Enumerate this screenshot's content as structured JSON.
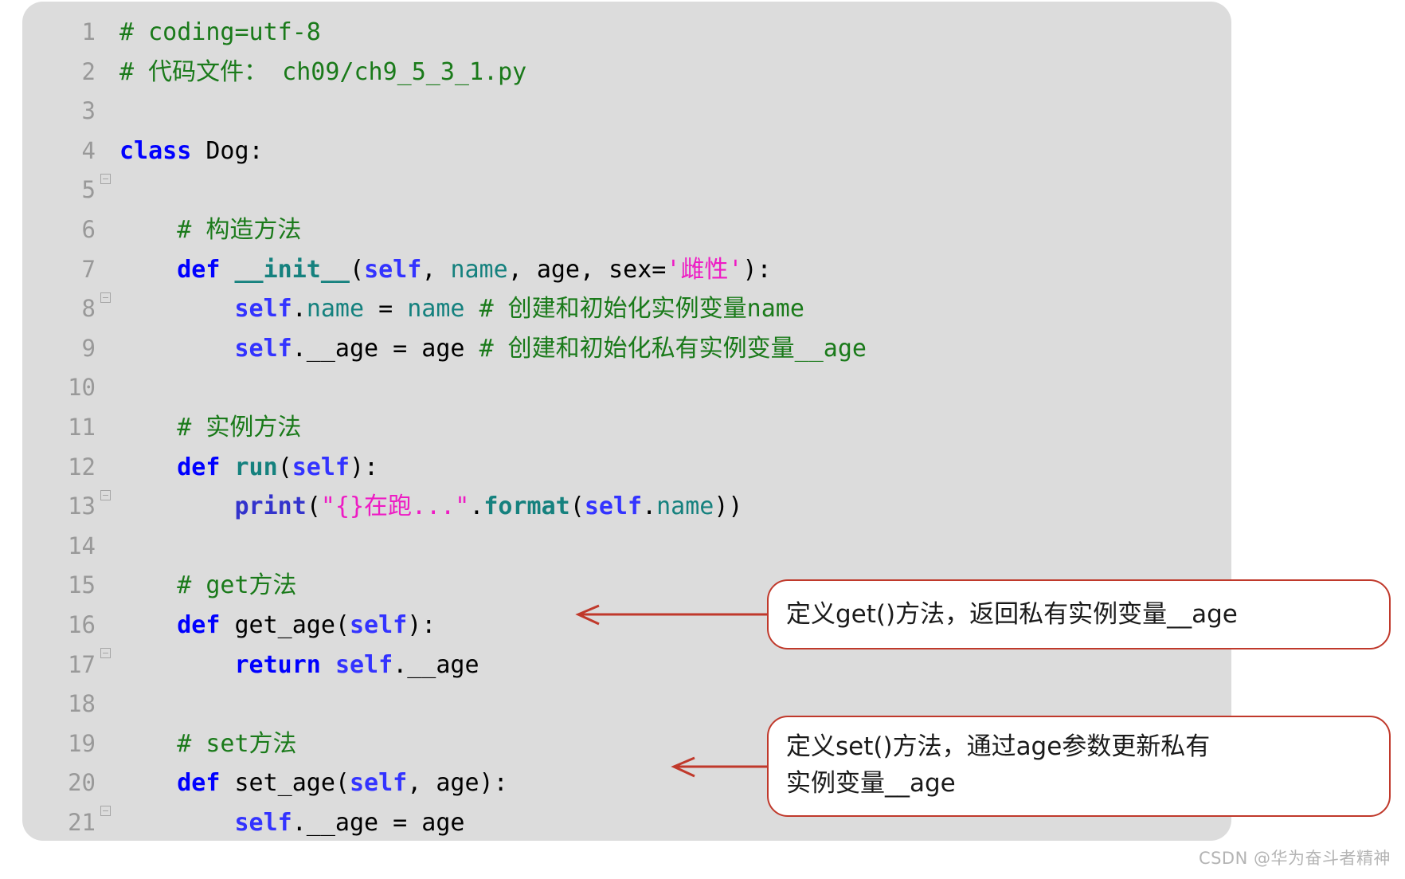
{
  "editor": {
    "language": "python",
    "background_color": "#dcdcdc",
    "line_number_color": "#999999",
    "fold_marker_icon": "minus-square-icon",
    "lines": [
      {
        "num": "1",
        "fold": false,
        "tokens": [
          {
            "t": "comment",
            "v": "# coding=utf-8"
          }
        ]
      },
      {
        "num": "2",
        "fold": false,
        "tokens": [
          {
            "t": "comment",
            "v": "# 代码文件："
          },
          {
            "t": "comment",
            "v": " ch09/ch9_5_3_1.py"
          }
        ]
      },
      {
        "num": "3",
        "fold": false,
        "tokens": []
      },
      {
        "num": "4",
        "fold": true,
        "tokens": [
          {
            "t": "kw",
            "v": "class"
          },
          {
            "t": "plain",
            "v": " Dog:"
          }
        ]
      },
      {
        "num": "5",
        "fold": false,
        "tokens": []
      },
      {
        "num": "6",
        "fold": false,
        "tokens": [
          {
            "t": "plain",
            "v": "    "
          },
          {
            "t": "comment",
            "v": "# 构造方法"
          }
        ]
      },
      {
        "num": "7",
        "fold": true,
        "tokens": [
          {
            "t": "plain",
            "v": "    "
          },
          {
            "t": "kw",
            "v": "def"
          },
          {
            "t": "plain",
            "v": " "
          },
          {
            "t": "fn",
            "v": "__init__"
          },
          {
            "t": "plain",
            "v": "("
          },
          {
            "t": "self",
            "v": "self"
          },
          {
            "t": "plain",
            "v": ", "
          },
          {
            "t": "param",
            "v": "name"
          },
          {
            "t": "plain",
            "v": ", "
          },
          {
            "t": "plain",
            "v": "age"
          },
          {
            "t": "plain",
            "v": ", "
          },
          {
            "t": "plain",
            "v": "sex="
          },
          {
            "t": "str",
            "v": "'雌性'"
          },
          {
            "t": "plain",
            "v": "):"
          }
        ]
      },
      {
        "num": "8",
        "fold": false,
        "tokens": [
          {
            "t": "plain",
            "v": "        "
          },
          {
            "t": "self",
            "v": "self"
          },
          {
            "t": "plain",
            "v": "."
          },
          {
            "t": "param",
            "v": "name"
          },
          {
            "t": "plain",
            "v": " = "
          },
          {
            "t": "param",
            "v": "name"
          },
          {
            "t": "plain",
            "v": " "
          },
          {
            "t": "comment",
            "v": "# 创建和初始化实例变量name"
          }
        ]
      },
      {
        "num": "9",
        "fold": false,
        "tokens": [
          {
            "t": "plain",
            "v": "        "
          },
          {
            "t": "self",
            "v": "self"
          },
          {
            "t": "plain",
            "v": ".__age = age "
          },
          {
            "t": "comment",
            "v": "# 创建和初始化私有实例变量__age"
          }
        ]
      },
      {
        "num": "10",
        "fold": false,
        "tokens": []
      },
      {
        "num": "11",
        "fold": false,
        "tokens": [
          {
            "t": "plain",
            "v": "    "
          },
          {
            "t": "comment",
            "v": "# 实例方法"
          }
        ]
      },
      {
        "num": "12",
        "fold": true,
        "tokens": [
          {
            "t": "plain",
            "v": "    "
          },
          {
            "t": "kw",
            "v": "def"
          },
          {
            "t": "plain",
            "v": " "
          },
          {
            "t": "fn",
            "v": "run"
          },
          {
            "t": "plain",
            "v": "("
          },
          {
            "t": "self",
            "v": "self"
          },
          {
            "t": "plain",
            "v": "):"
          }
        ]
      },
      {
        "num": "13",
        "fold": false,
        "tokens": [
          {
            "t": "plain",
            "v": "        "
          },
          {
            "t": "builtin",
            "v": "print"
          },
          {
            "t": "plain",
            "v": "("
          },
          {
            "t": "str",
            "v": "\"{}在跑...\""
          },
          {
            "t": "plain",
            "v": "."
          },
          {
            "t": "fn",
            "v": "format"
          },
          {
            "t": "plain",
            "v": "("
          },
          {
            "t": "self",
            "v": "self"
          },
          {
            "t": "plain",
            "v": "."
          },
          {
            "t": "param",
            "v": "name"
          },
          {
            "t": "plain",
            "v": "))"
          }
        ]
      },
      {
        "num": "14",
        "fold": false,
        "tokens": []
      },
      {
        "num": "15",
        "fold": false,
        "tokens": [
          {
            "t": "plain",
            "v": "    "
          },
          {
            "t": "comment",
            "v": "# get方法"
          }
        ]
      },
      {
        "num": "16",
        "fold": true,
        "tokens": [
          {
            "t": "plain",
            "v": "    "
          },
          {
            "t": "kw",
            "v": "def"
          },
          {
            "t": "plain",
            "v": " get_age("
          },
          {
            "t": "self",
            "v": "self"
          },
          {
            "t": "plain",
            "v": "):"
          }
        ]
      },
      {
        "num": "17",
        "fold": false,
        "tokens": [
          {
            "t": "plain",
            "v": "        "
          },
          {
            "t": "kw",
            "v": "return"
          },
          {
            "t": "plain",
            "v": " "
          },
          {
            "t": "self",
            "v": "self"
          },
          {
            "t": "plain",
            "v": ".__age"
          }
        ]
      },
      {
        "num": "18",
        "fold": false,
        "tokens": []
      },
      {
        "num": "19",
        "fold": false,
        "tokens": [
          {
            "t": "plain",
            "v": "    "
          },
          {
            "t": "comment",
            "v": "# set方法"
          }
        ]
      },
      {
        "num": "20",
        "fold": true,
        "tokens": [
          {
            "t": "plain",
            "v": "    "
          },
          {
            "t": "kw",
            "v": "def"
          },
          {
            "t": "plain",
            "v": " set_age("
          },
          {
            "t": "self",
            "v": "self"
          },
          {
            "t": "plain",
            "v": ", age):"
          }
        ]
      },
      {
        "num": "21",
        "fold": false,
        "tokens": [
          {
            "t": "plain",
            "v": "        "
          },
          {
            "t": "self",
            "v": "self"
          },
          {
            "t": "plain",
            "v": ".__age = age"
          }
        ]
      }
    ]
  },
  "callouts": [
    {
      "id": "get",
      "text": "定义get()方法，返回私有实例变量__age",
      "border_color": "#c0392b",
      "points_to_line": "16"
    },
    {
      "id": "set",
      "text": "定义set()方法，通过age参数更新私有实例变量__age",
      "line1": "定义set()方法，通过age参数更新私有",
      "line2": "实例变量__age",
      "border_color": "#c0392b",
      "points_to_line": "20"
    }
  ],
  "watermark": {
    "text": "CSDN @华为奋斗者精神",
    "color": "#b4b4b4"
  }
}
